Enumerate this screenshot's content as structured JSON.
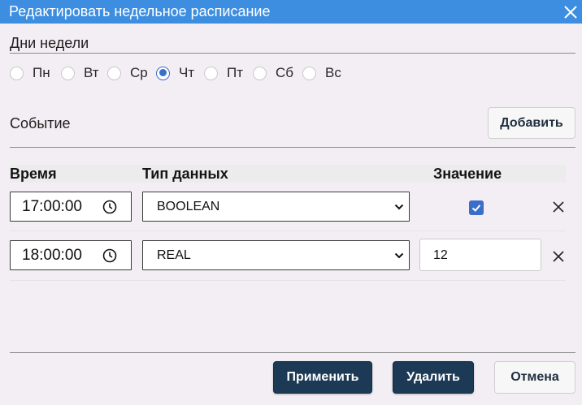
{
  "dialog": {
    "title": "Редактировать недельное расписание"
  },
  "days": {
    "label": "Дни недели",
    "items": [
      {
        "label": "Пн",
        "checked": false
      },
      {
        "label": "Вт",
        "checked": false
      },
      {
        "label": "Ср",
        "checked": false
      },
      {
        "label": "Чт",
        "checked": true
      },
      {
        "label": "Пт",
        "checked": false
      },
      {
        "label": "Сб",
        "checked": false
      },
      {
        "label": "Вс",
        "checked": false
      }
    ]
  },
  "events": {
    "label": "Событие",
    "add_label": "Добавить",
    "columns": {
      "time": "Время",
      "type": "Тип данных",
      "value": "Значение"
    },
    "rows": [
      {
        "time": "17:00:00",
        "type": "BOOLEAN",
        "value": "",
        "checked": true
      },
      {
        "time": "18:00:00",
        "type": "REAL",
        "value": "12"
      }
    ]
  },
  "footer": {
    "apply_label": "Применить",
    "delete_label": "Удалить",
    "cancel_label": "Отмена"
  },
  "colors": {
    "titlebar": "#3d8ee0",
    "primary_button": "#1c3a55",
    "accent": "#3a6ec8",
    "background": "#f3eef3"
  },
  "icons": {
    "close": "close-icon",
    "clock": "clock-icon",
    "chevron": "chevron-down-icon",
    "check": "check-icon",
    "remove": "remove-icon"
  }
}
